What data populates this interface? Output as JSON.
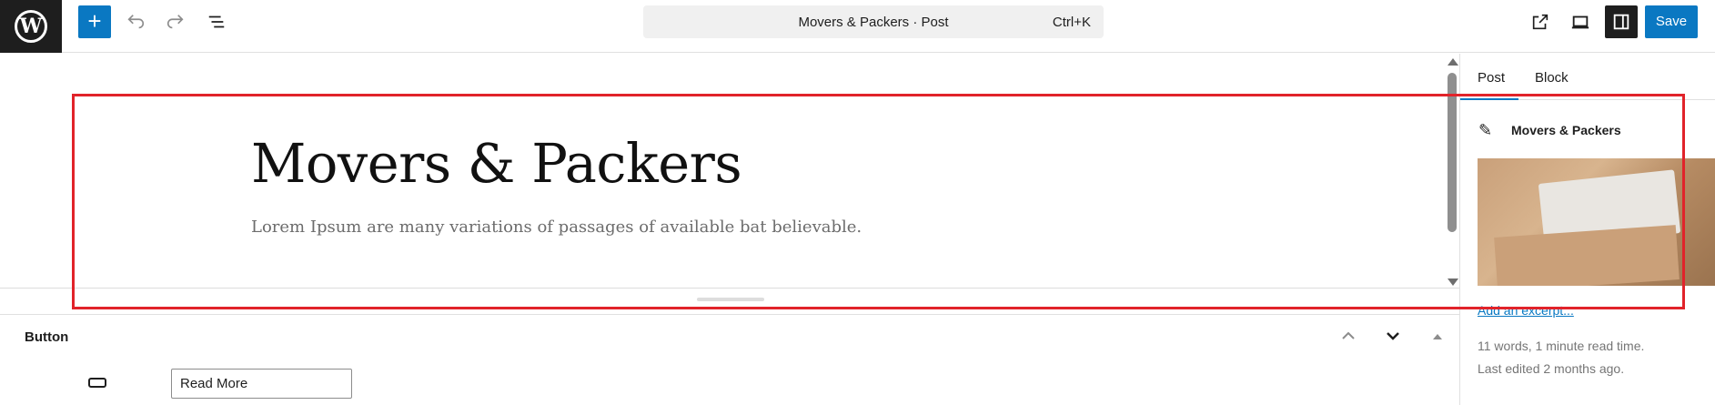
{
  "topbar": {
    "logo_letter": "W",
    "command_title": "Movers & Packers · Post",
    "command_shortcut": "Ctrl+K",
    "save_label": "Save",
    "icons": [
      "wordpress-icon",
      "plus-icon",
      "undo-icon",
      "redo-icon",
      "list-view-icon",
      "external-link-icon",
      "desktop-preview-icon",
      "sidebar-toggle-icon"
    ]
  },
  "canvas": {
    "title": "Movers & Packers",
    "subtitle": "Lorem Ipsum are many variations of passages of available bat believable."
  },
  "inspector": {
    "title": "Button",
    "button_text_value": "Read More"
  },
  "sidebar": {
    "tabs": [
      {
        "label": "Post"
      },
      {
        "label": "Block"
      }
    ],
    "post_name": "Movers & Packers",
    "excerpt_link": "Add an excerpt...",
    "word_count": "11 words, 1 minute read time.",
    "last_edited": "Last edited 2 months ago."
  },
  "colors": {
    "accent": "#0a78c2",
    "highlight_box": "#e1232a",
    "dark": "#1e1e1e"
  }
}
